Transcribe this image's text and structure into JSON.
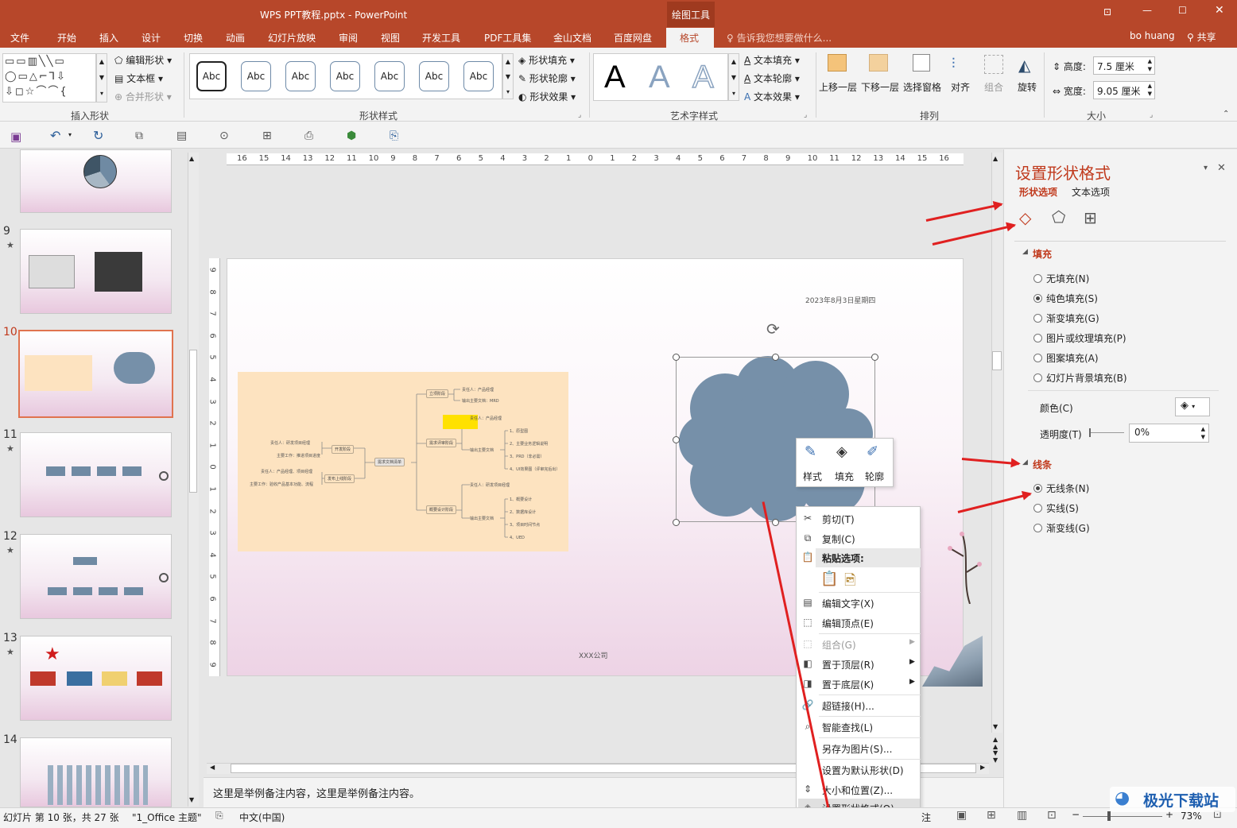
{
  "window": {
    "title": "WPS PPT教程.pptx - PowerPoint",
    "context_tab_group": "绘图工具",
    "user": "bo huang",
    "share": "共享"
  },
  "tabs": [
    "文件",
    "开始",
    "插入",
    "设计",
    "切换",
    "动画",
    "幻灯片放映",
    "审阅",
    "视图",
    "开发工具",
    "PDF工具集",
    "金山文档",
    "百度网盘",
    "格式"
  ],
  "tell_me": "告诉我您想要做什么...",
  "ribbon": {
    "insert_shapes": {
      "label": "插入形状",
      "edit_shape": "编辑形状",
      "text_box": "文本框",
      "merge_shapes": "合并形状"
    },
    "shape_styles": {
      "label": "形状样式",
      "abc": [
        "Abc",
        "Abc",
        "Abc",
        "Abc",
        "Abc",
        "Abc",
        "Abc"
      ],
      "fill": "形状填充",
      "outline": "形状轮廓",
      "effects": "形状效果"
    },
    "wordart": {
      "label": "艺术字样式",
      "letters": [
        "A",
        "A",
        "A"
      ],
      "text_fill": "文本填充",
      "text_outline": "文本轮廓",
      "text_effects": "文本效果"
    },
    "arrange": {
      "label": "排列",
      "bring_forward": "上移一层",
      "send_backward": "下移一层",
      "selection_pane": "选择窗格",
      "align": "对齐",
      "group": "组合",
      "rotate": "旋转"
    },
    "size": {
      "label": "大小",
      "height_label": "高度:",
      "height": "7.5 厘米",
      "width_label": "宽度:",
      "width": "9.05 厘米"
    }
  },
  "slides": [
    {
      "num": "",
      "star": false
    },
    {
      "num": "9",
      "star": true
    },
    {
      "num": "10",
      "star": false
    },
    {
      "num": "11",
      "star": true
    },
    {
      "num": "12",
      "star": true
    },
    {
      "num": "13",
      "star": true
    },
    {
      "num": "14",
      "star": false
    }
  ],
  "ruler_numbers": [
    "16",
    "15",
    "14",
    "13",
    "12",
    "11",
    "10",
    "9",
    "8",
    "7",
    "6",
    "5",
    "4",
    "3",
    "2",
    "1",
    "0",
    "1",
    "2",
    "3",
    "4",
    "5",
    "6",
    "7",
    "8",
    "9",
    "10",
    "11",
    "12",
    "13",
    "14",
    "15",
    "16"
  ],
  "vruler_numbers": [
    "9",
    "8",
    "7",
    "6",
    "5",
    "4",
    "3",
    "2",
    "1",
    "0",
    "1",
    "2",
    "3",
    "4",
    "5",
    "6",
    "7",
    "8",
    "9"
  ],
  "slide": {
    "date": "2023年8月3日星期四",
    "company": "XXX公司",
    "mindmap": {
      "center": "需求文档清单",
      "left": [
        "开发阶段",
        "发布上线阶段"
      ],
      "left_details": [
        "责任人：研发项目经理",
        "主要工作：推进项目进度",
        "责任人：产品经理、项目经理",
        "主要工作：验收产品基本功能、流程"
      ],
      "right": [
        "立项阶段",
        "需求评审阶段",
        "概要设计阶段"
      ],
      "right_details": [
        "责任人：产品经理",
        "输出主要文档：MRD",
        "责任人：产品经理",
        "输出主要文档",
        "1、原型图",
        "2、主要业务逻辑说明",
        "3、PRD（非必需）",
        "4、UI效果图（评审完后出）",
        "责任人：研发项目经理",
        "输出主要文档",
        "1、概要设计",
        "2、数据库设计",
        "3、项目时间节点",
        "4、UED"
      ]
    }
  },
  "notes": "这里是举例备注内容，这里是举例备注内容。",
  "mini_toolbar": [
    "样式",
    "填充",
    "轮廓"
  ],
  "context_menu": {
    "cut": "剪切(T)",
    "copy": "复制(C)",
    "paste_options": "粘贴选项:",
    "edit_text": "编辑文字(X)",
    "edit_points": "编辑顶点(E)",
    "group": "组合(G)",
    "bring_front": "置于顶层(R)",
    "send_back": "置于底层(K)",
    "hyperlink": "超链接(H)...",
    "smart_lookup": "智能查找(L)",
    "save_as_picture": "另存为图片(S)...",
    "set_default": "设置为默认形状(D)",
    "size_position": "大小和位置(Z)...",
    "format_shape": "设置形状格式(O)..."
  },
  "format_panel": {
    "title": "设置形状格式",
    "tab_shape": "形状选项",
    "tab_text": "文本选项",
    "fill_section": "填充",
    "fill_options": [
      "无填充(N)",
      "纯色填充(S)",
      "渐变填充(G)",
      "图片或纹理填充(P)",
      "图案填充(A)",
      "幻灯片背景填充(B)"
    ],
    "fill_selected": 1,
    "color_label": "颜色(C)",
    "transparency_label": "透明度(T)",
    "transparency": "0%",
    "line_section": "线条",
    "line_options": [
      "无线条(N)",
      "实线(S)",
      "渐变线(G)"
    ],
    "line_selected": 0
  },
  "status": {
    "slide_info": "幻灯片 第 10 张，共 27 张",
    "theme": "\"1_Office 主题\"",
    "language": "中文(中国)",
    "notes": "注",
    "zoom": "73%"
  },
  "watermark": "极光下载站",
  "colors": {
    "accent": "#b7472a",
    "cloud": "#7690a9",
    "panel_accent": "#c0391c",
    "arrow": "#e02020"
  }
}
